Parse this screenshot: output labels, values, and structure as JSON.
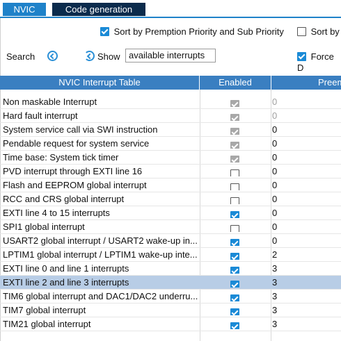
{
  "tabs": [
    {
      "label": "NVIC",
      "active": true
    },
    {
      "label": "Code generation",
      "active": false
    }
  ],
  "options": {
    "sort_priority": {
      "label": "Sort by Premption Priority and Sub Priority",
      "checked": true
    },
    "sort_other": {
      "label": "Sort by",
      "checked": false
    },
    "force": {
      "label": "Force D",
      "checked": true
    }
  },
  "search": {
    "label": "Search",
    "show_label": "Show",
    "show_value": "available interrupts"
  },
  "table": {
    "columns": [
      "NVIC Interrupt Table",
      "Enabled",
      "Preem"
    ],
    "rows": [
      {
        "name": "Non maskable Interrupt",
        "enabled": true,
        "locked": true,
        "preemption": "0",
        "selected": false
      },
      {
        "name": "Hard fault interrupt",
        "enabled": true,
        "locked": true,
        "preemption": "0",
        "selected": false
      },
      {
        "name": "System service call via SWI instruction",
        "enabled": true,
        "locked": true,
        "preemption": "0",
        "selected": false
      },
      {
        "name": "Pendable request for system service",
        "enabled": true,
        "locked": true,
        "preemption": "0",
        "selected": false
      },
      {
        "name": "Time base: System tick timer",
        "enabled": true,
        "locked": true,
        "preemption": "0",
        "selected": false
      },
      {
        "name": "PVD interrupt through EXTI line 16",
        "enabled": false,
        "locked": false,
        "preemption": "0",
        "selected": false
      },
      {
        "name": "Flash and EEPROM global interrupt",
        "enabled": false,
        "locked": false,
        "preemption": "0",
        "selected": false
      },
      {
        "name": "RCC and CRS global interrupt",
        "enabled": false,
        "locked": false,
        "preemption": "0",
        "selected": false
      },
      {
        "name": "EXTI line 4 to 15 interrupts",
        "enabled": true,
        "locked": false,
        "preemption": "0",
        "selected": false
      },
      {
        "name": "SPI1 global interrupt",
        "enabled": false,
        "locked": false,
        "preemption": "0",
        "selected": false
      },
      {
        "name": "USART2 global interrupt / USART2 wake-up in...",
        "enabled": true,
        "locked": false,
        "preemption": "0",
        "selected": false
      },
      {
        "name": "LPTIM1 global interrupt / LPTIM1 wake-up inte...",
        "enabled": true,
        "locked": false,
        "preemption": "2",
        "selected": false
      },
      {
        "name": "EXTI line 0 and line 1 interrupts",
        "enabled": true,
        "locked": false,
        "preemption": "3",
        "selected": false
      },
      {
        "name": "EXTI line 2 and line 3 interrupts",
        "enabled": true,
        "locked": false,
        "preemption": "3",
        "selected": true
      },
      {
        "name": "TIM6 global interrupt and DAC1/DAC2 underru...",
        "enabled": true,
        "locked": false,
        "preemption": "3",
        "selected": false
      },
      {
        "name": "TIM7 global interrupt",
        "enabled": true,
        "locked": false,
        "preemption": "3",
        "selected": false
      },
      {
        "name": "TIM21 global interrupt",
        "enabled": true,
        "locked": false,
        "preemption": "3",
        "selected": false
      }
    ]
  }
}
